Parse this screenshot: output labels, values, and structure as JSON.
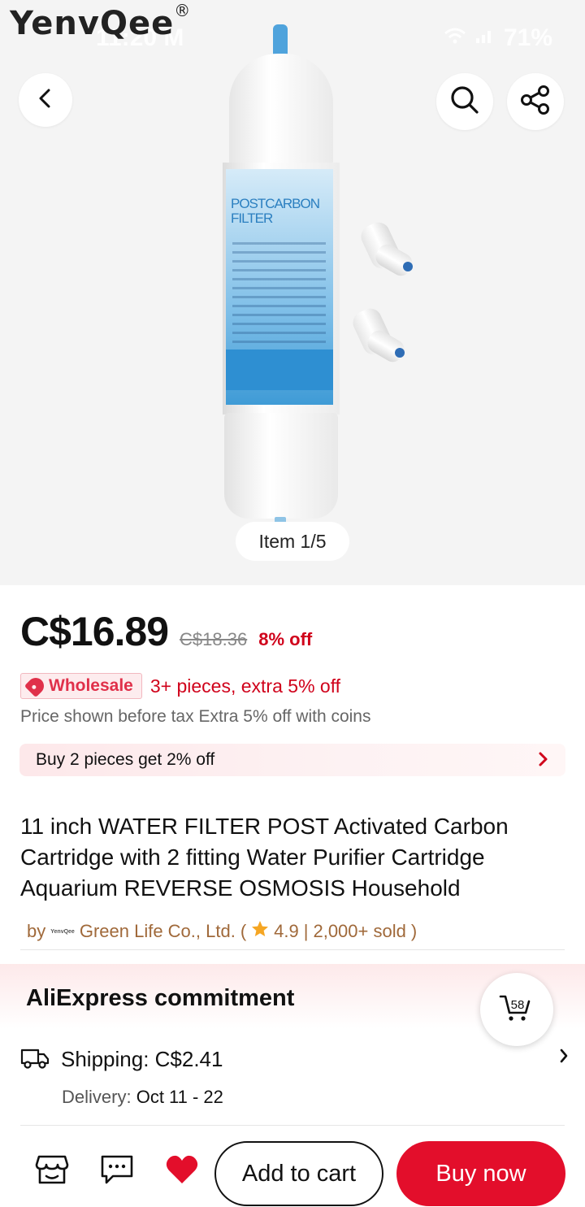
{
  "hero": {
    "brand_logo": "YenvQee",
    "brand_mark": "®",
    "status_time": "11:20 M",
    "status_battery": "71%",
    "label_title": "POSTCARBON FILTER",
    "item_counter": "Item 1/5"
  },
  "price": {
    "current": "C$16.89",
    "original": "C$18.36",
    "discount": "8% off"
  },
  "wholesale": {
    "badge": "Wholesale",
    "text": "3+ pieces, extra 5% off"
  },
  "tax_note": "Price shown before tax Extra 5% off with coins",
  "promo": {
    "text": "Buy 2 pieces get 2% off"
  },
  "product": {
    "title": "11 inch WATER FILTER POST Activated Carbon Cartridge with 2 fitting Water Purifier Cartridge Aquarium REVERSE OSMOSIS Household"
  },
  "seller": {
    "prefix": "by",
    "mini_logo": "YenvQee",
    "name": "Green Life Co., Ltd.",
    "open_paren": "(",
    "rating": "4.9",
    "separator": "|",
    "sold": "2,000+ sold",
    "close_paren": ")"
  },
  "commitment": {
    "title": "AliExpress commitment",
    "cart_count": "58"
  },
  "shipping": {
    "text": "Shipping: C$2.41",
    "delivery_label": "Delivery:",
    "delivery_dates": "Oct 11 - 22"
  },
  "bottom_bar": {
    "add_to_cart": "Add to cart",
    "buy_now": "Buy now"
  },
  "colors": {
    "accent_red": "#e30e2b",
    "discount_red": "#d0021b",
    "seller_brown": "#a0693a",
    "filter_blue": "#3f9bd6"
  },
  "icons": [
    "back-arrow-icon",
    "search-icon",
    "share-icon",
    "tag-icon",
    "chevron-right-icon",
    "star-icon",
    "truck-icon",
    "cart-icon",
    "store-icon",
    "chat-icon",
    "heart-icon"
  ]
}
